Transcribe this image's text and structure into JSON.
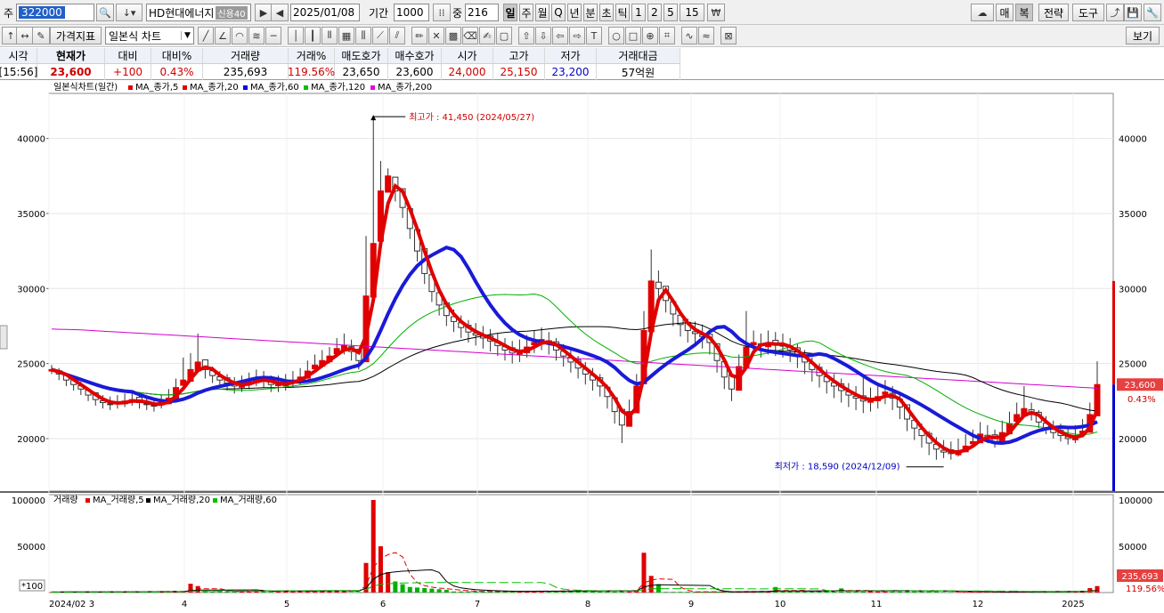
{
  "toolbar": {
    "code_prefix": "주",
    "code": "322000",
    "stock_name": "HD현대에너지",
    "stock_badge": "신용40",
    "date": "2025/01/08",
    "period_label": "기간",
    "period_value": "1000",
    "middle_label": "중",
    "middle_value": "216",
    "interval_buttons": [
      "일",
      "주",
      "월",
      "Q",
      "년",
      "분",
      "초",
      "틱",
      "1",
      "2",
      "5",
      "15"
    ],
    "right_buttons": [
      "매",
      "복",
      "전략",
      "도구"
    ],
    "indicator_label": "가격지표",
    "chart_type": "일본식 차트",
    "view_label": "보기"
  },
  "quote": {
    "headers": [
      "시각",
      "현재가",
      "대비",
      "대비%",
      "거래량",
      "거래%",
      "매도호가",
      "매수호가",
      "시가",
      "고가",
      "저가",
      "거래대금"
    ],
    "values": [
      "[15:56]",
      "23,600",
      "+100",
      "0.43%",
      "235,693",
      "119.56%",
      "23,650",
      "23,600",
      "24,000",
      "25,150",
      "23,200",
      "57억원"
    ],
    "colors": {
      "up": "#d00000",
      "down": "#0000cc",
      "neutral": "#000000"
    }
  },
  "chart_data": {
    "type": "candlestick",
    "price_legend_title": "일본식차트(일간)",
    "price_legend": [
      {
        "name": "MA_종가,5",
        "color": "#e00000"
      },
      {
        "name": "MA_종가,20",
        "color": "#e00000"
      },
      {
        "name": "MA_종가,60",
        "color": "#0000e0"
      },
      {
        "name": "MA_종가,120",
        "color": "#00c000"
      },
      {
        "name": "MA_종가,200",
        "color": "#e000e0"
      }
    ],
    "volume_legend_title": "거래량",
    "volume_legend": [
      {
        "name": "MA_거래량,5",
        "color": "#e00000"
      },
      {
        "name": "MA_거래량,20",
        "color": "#000000"
      },
      {
        "name": "MA_거래량,60",
        "color": "#00c000"
      }
    ],
    "price_axis": {
      "min": 16500,
      "max": 43000,
      "ticks": [
        20000,
        25000,
        30000,
        35000,
        40000
      ]
    },
    "volume_axis": {
      "min": 0,
      "max": 100000,
      "ticks": [
        50000,
        100000
      ],
      "unit_label": "*100"
    },
    "x_axis_labels": [
      "2024/02 3",
      "4",
      "5",
      "6",
      "7",
      "8",
      "9",
      "10",
      "11",
      "12",
      "2025"
    ],
    "high_annotation": "최고가 : 41,450 (2024/05/27)",
    "low_annotation": "최저가 : 18,590 (2024/12/09)",
    "last_price_label": "23,600",
    "last_change_label": "0.43%",
    "last_volume_label": "235,693",
    "last_volume_pct_label": "119.56%",
    "closes": [
      24600,
      24300,
      23900,
      23600,
      23300,
      22900,
      22600,
      22400,
      22300,
      22400,
      22500,
      22600,
      22400,
      22300,
      22200,
      22400,
      22700,
      23400,
      23900,
      24600,
      25100,
      24600,
      24200,
      23900,
      23700,
      23500,
      23600,
      23800,
      24000,
      23900,
      23600,
      23600,
      23700,
      23900,
      24100,
      24500,
      24900,
      25200,
      25500,
      26000,
      26200,
      25800,
      25200,
      29500,
      33000,
      36500,
      37500,
      36500,
      35400,
      34000,
      32500,
      31000,
      29800,
      28900,
      28200,
      27800,
      27400,
      27100,
      26900,
      26700,
      26500,
      26200,
      25900,
      25700,
      25800,
      26100,
      26400,
      26600,
      26300,
      25900,
      25500,
      25100,
      24700,
      24300,
      23900,
      23500,
      22800,
      21800,
      20900,
      21800,
      23500,
      27200,
      30500,
      30000,
      29200,
      28300,
      27600,
      27200,
      27000,
      26800,
      26400,
      25200,
      24100,
      23300,
      24800,
      26100,
      26400,
      26200,
      26400,
      26300,
      26200,
      25900,
      25500,
      25100,
      24600,
      24200,
      23800,
      23500,
      23200,
      22900,
      22700,
      22500,
      22600,
      22800,
      23100,
      22700,
      22100,
      21300,
      20700,
      20200,
      19700,
      19300,
      19100,
      19000,
      19200,
      19500,
      19800,
      20300,
      20100,
      19800,
      20400,
      21000,
      21600,
      22000,
      21600,
      21100,
      20700,
      20400,
      20200,
      20000,
      20100,
      20500,
      21600,
      23600
    ],
    "highs": [
      24900,
      24700,
      24300,
      24100,
      23800,
      23400,
      23100,
      22900,
      22800,
      22900,
      23000,
      23100,
      22900,
      22800,
      22700,
      22900,
      23300,
      24000,
      25400,
      25700,
      27000,
      25200,
      24800,
      24500,
      24300,
      24100,
      24200,
      24400,
      24600,
      24500,
      24200,
      24200,
      24300,
      24500,
      24700,
      25200,
      25600,
      25900,
      26100,
      26700,
      27000,
      26600,
      25900,
      33500,
      41450,
      38500,
      38000,
      37200,
      36100,
      34800,
      33400,
      31900,
      30600,
      29700,
      29000,
      28600,
      28200,
      27900,
      27700,
      27500,
      27300,
      27000,
      26700,
      26500,
      26600,
      26900,
      27200,
      27400,
      27100,
      26700,
      26300,
      25900,
      25500,
      25100,
      24700,
      24300,
      23600,
      22600,
      21700,
      22600,
      24300,
      28500,
      32600,
      31200,
      30000,
      29100,
      28400,
      28000,
      27800,
      27600,
      27200,
      26000,
      24900,
      24100,
      25600,
      28500,
      27200,
      27000,
      27200,
      27100,
      27000,
      26700,
      26300,
      25900,
      25400,
      25000,
      24600,
      24300,
      24000,
      23700,
      23500,
      24300,
      23400,
      23600,
      23900,
      23500,
      22900,
      22100,
      21500,
      21000,
      20500,
      20100,
      19900,
      19800,
      20000,
      20300,
      20600,
      21100,
      20900,
      20600,
      21200,
      21800,
      22400,
      23500,
      22400,
      21900,
      21500,
      21200,
      21000,
      20800,
      20900,
      21300,
      22400,
      25150
    ],
    "lows": [
      24300,
      23900,
      23500,
      23200,
      22900,
      22500,
      22200,
      22000,
      21900,
      22000,
      22100,
      22200,
      22000,
      21900,
      21800,
      22000,
      22300,
      23000,
      23500,
      24000,
      24500,
      24000,
      23700,
      23400,
      23200,
      23000,
      23100,
      23300,
      23500,
      23400,
      23100,
      23100,
      23200,
      23400,
      23600,
      24000,
      24400,
      24700,
      25000,
      25400,
      25600,
      25200,
      24600,
      28000,
      32000,
      35500,
      36800,
      35800,
      34700,
      33300,
      31800,
      30300,
      29100,
      28200,
      27500,
      27100,
      26700,
      26400,
      26200,
      26000,
      25800,
      25500,
      25200,
      25000,
      25100,
      25400,
      25700,
      25900,
      25600,
      25200,
      24800,
      24400,
      24000,
      23600,
      23200,
      22800,
      22000,
      21000,
      19700,
      21000,
      22800,
      26500,
      29500,
      29200,
      28400,
      27500,
      26800,
      26400,
      26200,
      26000,
      25600,
      24400,
      23300,
      22500,
      24000,
      25300,
      25600,
      25400,
      25600,
      25500,
      25400,
      25100,
      24700,
      24300,
      23800,
      23400,
      23000,
      22700,
      22400,
      22100,
      21900,
      21700,
      21800,
      22000,
      22300,
      21900,
      21300,
      20500,
      19900,
      19400,
      18900,
      18590,
      18700,
      18600,
      18800,
      19100,
      19400,
      19900,
      19700,
      19400,
      20000,
      20600,
      21200,
      21500,
      21200,
      20700,
      20300,
      20000,
      19800,
      19600,
      19700,
      20100,
      21200,
      23200
    ]
  }
}
